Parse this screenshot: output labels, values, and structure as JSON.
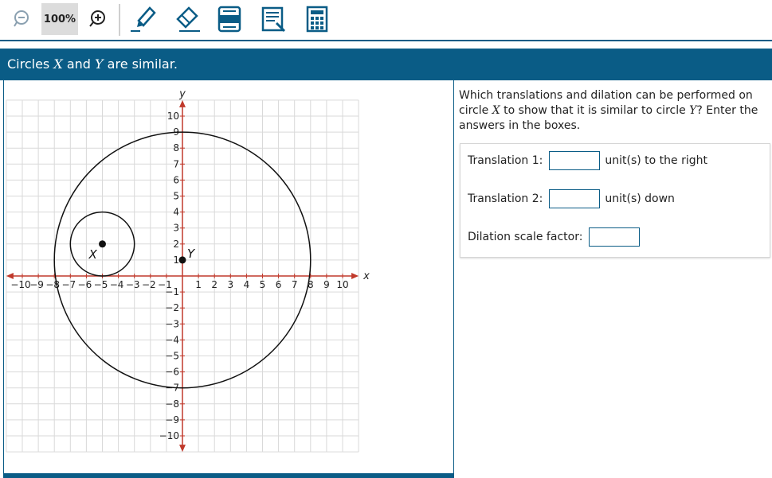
{
  "toolbar": {
    "zoom_level": "100%",
    "tools": [
      "zoom-out-icon",
      "zoom-in-icon",
      "highlighter-icon",
      "eraser-icon",
      "line-reader-icon",
      "notepad-icon",
      "calculator-icon"
    ]
  },
  "prompt": {
    "pre": "Circles ",
    "x": "X",
    "mid": " and ",
    "y": "Y",
    "post": " are similar."
  },
  "graph": {
    "x_axis_label": "x",
    "y_axis_label": "y",
    "x_ticks": [
      "−10",
      "−9",
      "−8",
      "−7",
      "−6",
      "−5",
      "−4",
      "−3",
      "−2",
      "−1",
      "1",
      "2",
      "3",
      "4",
      "5",
      "6",
      "7",
      "8",
      "9",
      "10"
    ],
    "y_ticks": [
      "10",
      "9",
      "8",
      "7",
      "6",
      "5",
      "4",
      "3",
      "2",
      "1",
      "−1",
      "−2",
      "−3",
      "−4",
      "−5",
      "−6",
      "−7",
      "−8",
      "−9",
      "−10"
    ],
    "circle_x": {
      "label": "X",
      "center": [
        -5,
        2
      ],
      "radius": 2
    },
    "circle_y": {
      "label": "Y",
      "center": [
        0,
        1
      ],
      "radius": 8
    },
    "colors": {
      "axis": "#c0392b",
      "grid": "#d9d9d9",
      "circle": "#111111"
    }
  },
  "question": {
    "p1": "Which translations and dilation can be performed on circle ",
    "x": "X",
    "p2": " to show that it is similar to circle ",
    "y": "Y",
    "p3": "? Enter the answers in the boxes."
  },
  "answers": {
    "t1_label": "Translation 1:",
    "t1_unit": "unit(s) to the right",
    "t1_value": "",
    "t2_label": "Translation 2:",
    "t2_unit": "unit(s) down",
    "t2_value": "",
    "d_label": "Dilation scale factor:",
    "d_value": ""
  },
  "colors": {
    "accent": "#0a5c86"
  }
}
